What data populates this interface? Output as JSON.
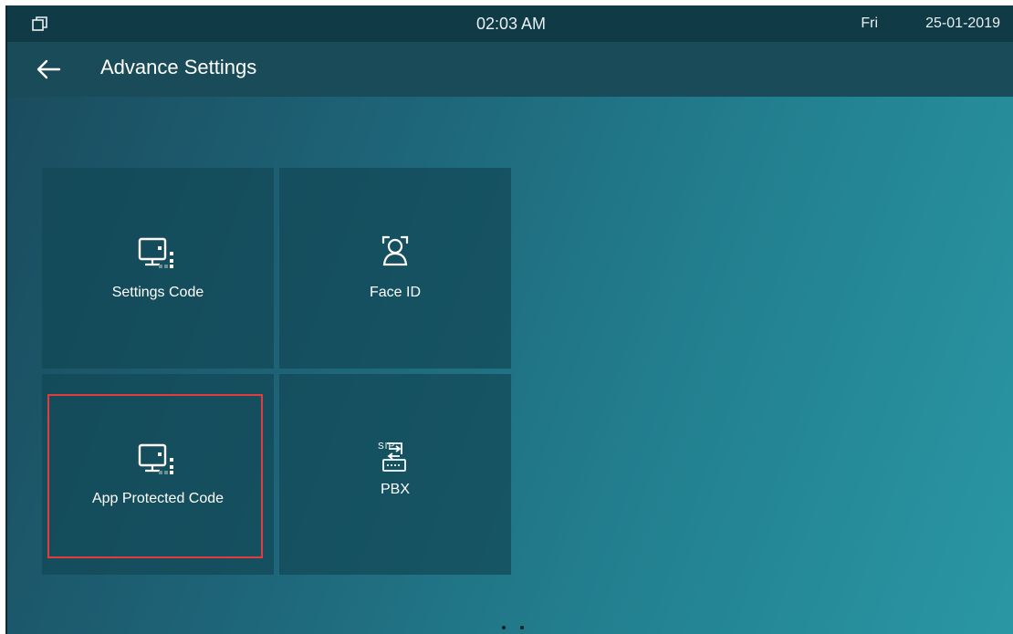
{
  "statusbar": {
    "time": "02:03 AM",
    "day": "Fri",
    "date": "25-01-2019",
    "window_icon": "window-restore-icon"
  },
  "header": {
    "title": "Advance Settings",
    "back_icon": "arrow-left-icon"
  },
  "tiles": [
    {
      "label": "Settings Code",
      "icon": "monitor-qr-icon"
    },
    {
      "label": "Face ID",
      "icon": "face-scan-icon"
    },
    {
      "label": "App Protected Code",
      "icon": "monitor-qr-icon",
      "highlighted": true
    },
    {
      "label": "PBX",
      "icon": "sip-pbx-icon",
      "icon_text": "SIP"
    }
  ],
  "pagination": {
    "pages": 2
  },
  "colors": {
    "highlight": "#e23d3d",
    "statusbar_bg": "#0f3a46",
    "header_bg": "#1a4b58",
    "tile_bg": "#124856"
  }
}
